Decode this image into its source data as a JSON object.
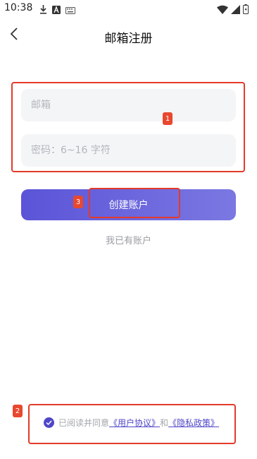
{
  "status_bar": {
    "time": "10:38",
    "icons": [
      "download-icon",
      "font-a-icon",
      "keyboard-icon",
      "wifi-icon",
      "signal-icon",
      "battery-icon"
    ]
  },
  "header": {
    "back_icon": "chevron-left-icon",
    "title": "邮箱注册"
  },
  "form": {
    "email_placeholder": "邮箱",
    "password_placeholder": "密码：6~16 字符",
    "create_button": "创建账户",
    "have_account": "我已有账户"
  },
  "agreement": {
    "checked": true,
    "prefix": "已阅读并同意",
    "user_agreement": "《用户协议》",
    "conjunction": "和",
    "privacy_policy": "《隐私政策》"
  },
  "annotations": [
    "1",
    "2",
    "3"
  ],
  "colors": {
    "accent": "#5b54d8",
    "accent_light": "#7b78e2",
    "input_bg": "#f4f5f7",
    "annotation": "#e33a2a"
  }
}
